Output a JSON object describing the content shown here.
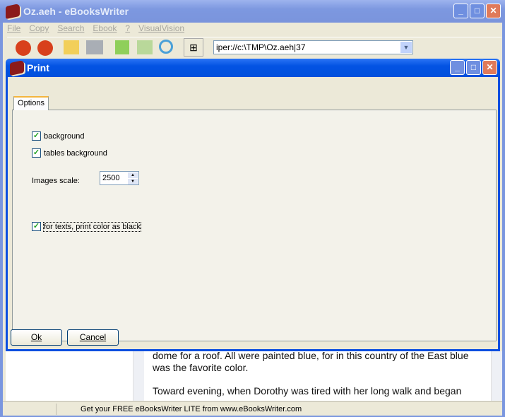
{
  "app": {
    "title": "Oz.aeh - eBooksWriter"
  },
  "menu": [
    "File",
    "Copy",
    "Search",
    "Ebook",
    "?",
    "VisualVision"
  ],
  "toolbar": {
    "address": "iper://c:\\TMP\\Oz.aeh|37"
  },
  "dialog": {
    "title": "Print",
    "tab": "Options",
    "options": {
      "background": {
        "label": "background",
        "checked": true
      },
      "tables_background": {
        "label": "tables background",
        "checked": true
      },
      "images_scale": {
        "label": "Images scale:",
        "value": "2500"
      },
      "print_black": {
        "label": "for texts, print color as black",
        "checked": true
      }
    },
    "ok_label": "Ok",
    "cancel_label": "Cancel"
  },
  "content": {
    "para1": "dome for a roof. All were painted blue, for in this country of the East blue was the favorite color.",
    "para2": "Toward evening, when Dorothy was tired with her long walk and began"
  },
  "status": {
    "text": "Get your FREE eBooksWriter LITE from www.eBooksWriter.com"
  },
  "colors": {
    "dialog_title": "#0353e3",
    "inactive_title": "#7d98e0",
    "face": "#ece9d8"
  }
}
